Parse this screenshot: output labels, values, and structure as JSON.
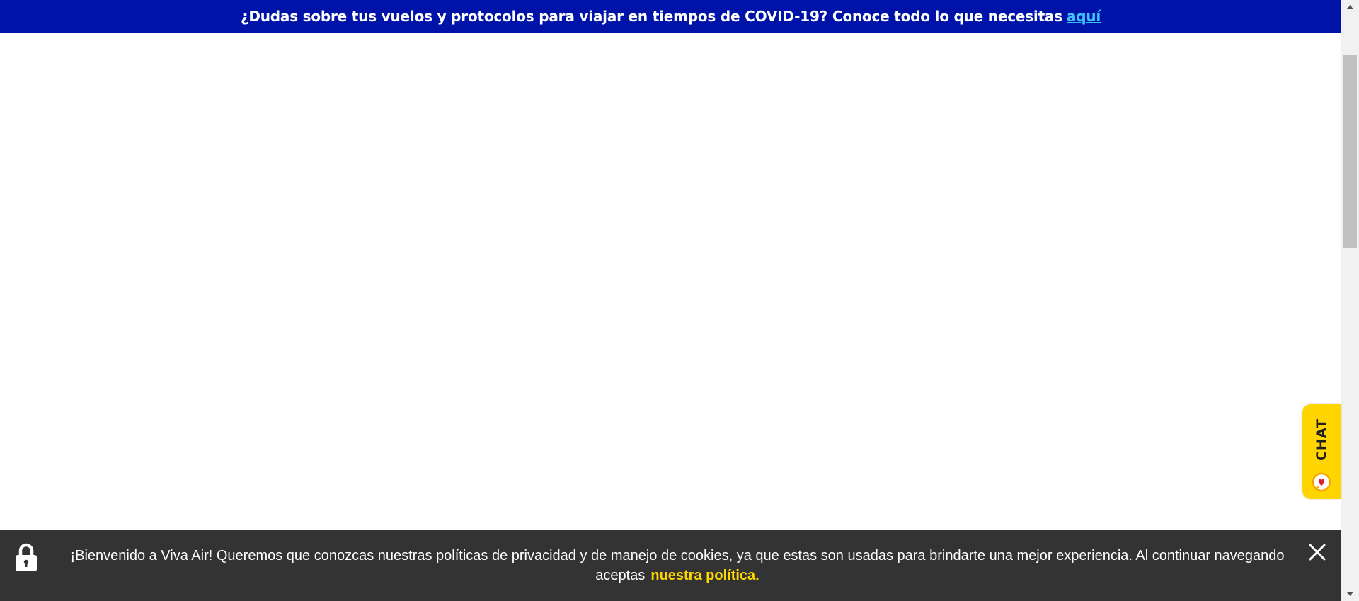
{
  "top_banner": {
    "message": "¿Dudas sobre tus vuelos y protocolos para viajar en tiempos de COVID-19? Conoce todo lo que necesitas",
    "link_label": "aquí",
    "background_color": "#0013a8",
    "link_color": "#3ec3ff"
  },
  "chat": {
    "label": "CHAT",
    "icon": "chat-heart-icon",
    "color": "#ffd500"
  },
  "cookie_bar": {
    "icon": "lock-icon",
    "message": "¡Bienvenido a Viva Air! Queremos que conozcas nuestras políticas de privacidad y de manejo de cookies, ya que estas son usadas para brindarte una mejor experiencia. Al continuar navegando aceptas",
    "policy_link_label": "nuestra política.",
    "close_icon": "close-icon",
    "background_color": "#333333",
    "link_color": "#ffd700"
  }
}
